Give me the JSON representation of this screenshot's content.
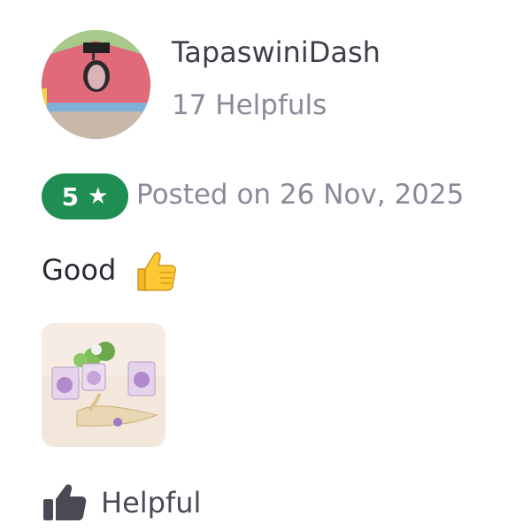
{
  "reviewer": {
    "name": "TapaswiniDash",
    "helpful_count": "17 Helpfuls"
  },
  "rating": {
    "value": "5",
    "icon": "star-icon"
  },
  "posted_date": "Posted on 26 Nov, 2025",
  "review": {
    "text": "Good",
    "emoji": "thumbs-up-emoji"
  },
  "helpful_button": {
    "label": "Helpful",
    "icon": "thumbs-up-icon"
  },
  "colors": {
    "rating_badge": "#1e8e53",
    "primary_text": "#3f3f4a",
    "secondary_text": "#8a8a99"
  }
}
